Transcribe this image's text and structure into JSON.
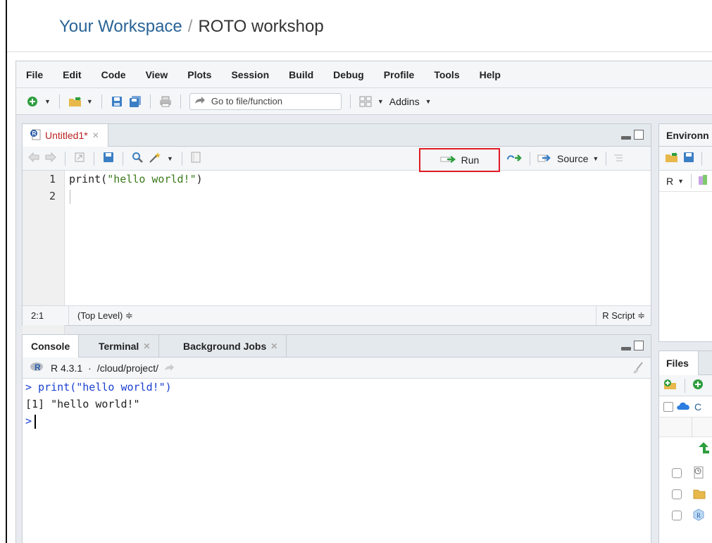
{
  "header": {
    "workspace_link": "Your Workspace",
    "separator": "/",
    "project": "ROTO workshop"
  },
  "menubar": [
    "File",
    "Edit",
    "Code",
    "View",
    "Plots",
    "Session",
    "Build",
    "Debug",
    "Profile",
    "Tools",
    "Help"
  ],
  "toolbar": {
    "goto_placeholder": "Go to file/function",
    "addins_label": "Addins"
  },
  "editor": {
    "tab_label": "Untitled1*",
    "run_label": "Run",
    "source_label": "Source",
    "lines": [
      {
        "num": "1",
        "fn": "print(",
        "str": "\"hello world!\"",
        "end": ")"
      },
      {
        "num": "2"
      }
    ],
    "status_position": "2:1",
    "status_scope": "(Top Level) ≑",
    "status_type": "R Script ≑"
  },
  "console": {
    "tabs": [
      {
        "label": "Console"
      },
      {
        "label": "Terminal"
      },
      {
        "label": "Background Jobs"
      }
    ],
    "version": "R 4.3.1",
    "path": "/cloud/project/",
    "output": [
      {
        "text": "> print(\"hello world!\")",
        "color": "#1a3fd0"
      },
      {
        "text": "[1] \"hello world!\"",
        "color": "#222222"
      }
    ],
    "prompt": ">"
  },
  "environment": {
    "title": "Environn",
    "r_label": "R"
  },
  "files": {
    "title": "Files",
    "cloud_label": "C"
  },
  "colors": {
    "accent": "#2a6496",
    "run_highlight": "#e01b24"
  }
}
